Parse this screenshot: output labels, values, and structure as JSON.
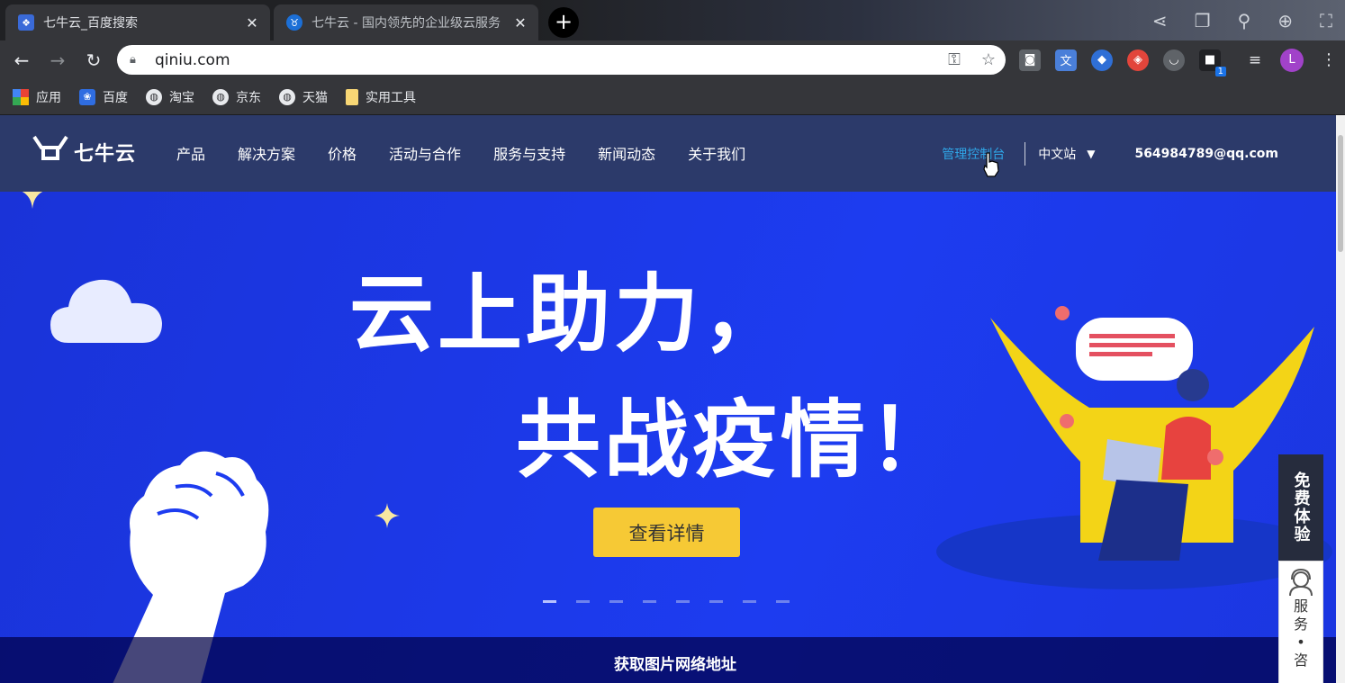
{
  "browser": {
    "tabs": [
      {
        "title": "七牛云_百度搜索",
        "state": "inactive"
      },
      {
        "title": "七牛云 - 国内领先的企业级云服务",
        "state": "active"
      }
    ],
    "url": "qiniu.com",
    "profile_initial": "L",
    "extension_badge": "1",
    "bookmarks": [
      {
        "label": "应用",
        "icon": "apps-grid-icon"
      },
      {
        "label": "百度",
        "icon": "baidu-paw-icon"
      },
      {
        "label": "淘宝",
        "icon": "globe-icon"
      },
      {
        "label": "京东",
        "icon": "globe-icon"
      },
      {
        "label": "天猫",
        "icon": "globe-icon"
      },
      {
        "label": "实用工具",
        "icon": "folder-icon"
      }
    ]
  },
  "site": {
    "logo_text": "七牛云",
    "menu": [
      "产品",
      "解决方案",
      "价格",
      "活动与合作",
      "服务与支持",
      "新闻动态",
      "关于我们"
    ],
    "console_link": "管理控制台",
    "language": "中文站",
    "account": "564984789@qq.com"
  },
  "hero": {
    "line1": "云上助力，",
    "line2": "共战疫情！",
    "cta": "查看详情",
    "carousel_count": 8,
    "carousel_active": 0
  },
  "side_panel": {
    "trial": "免费体验",
    "service": [
      "服",
      "务",
      "•",
      "咨"
    ]
  },
  "overlay": {
    "label": "获取图片网络地址"
  },
  "colors": {
    "accent_yellow": "#f6c935",
    "hero_blue": "#1d3cf0",
    "nav_bg": "#2c3a6a",
    "console_blue": "#2fa6e8"
  }
}
